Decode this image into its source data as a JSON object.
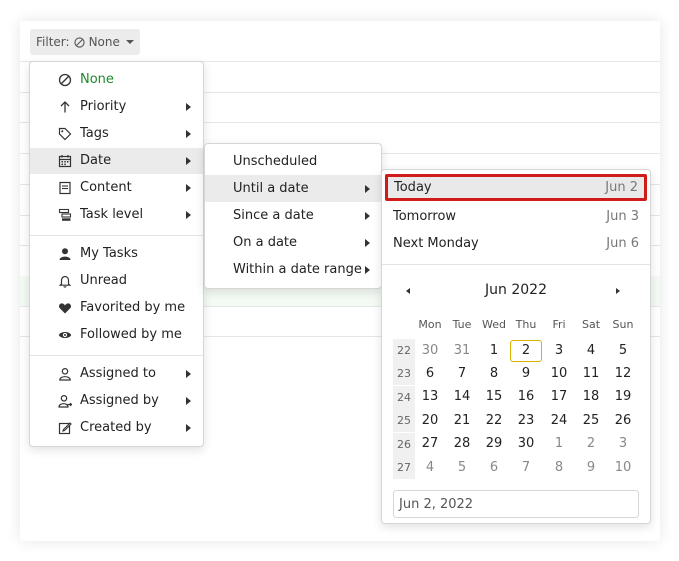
{
  "filter": {
    "label": "Filter:",
    "value": "None"
  },
  "main_menu": {
    "items": [
      {
        "label": "None"
      },
      {
        "label": "Priority"
      },
      {
        "label": "Tags"
      },
      {
        "label": "Date"
      },
      {
        "label": "Content"
      },
      {
        "label": "Task level"
      },
      {
        "label": "My Tasks"
      },
      {
        "label": "Unread"
      },
      {
        "label": "Favorited by me"
      },
      {
        "label": "Followed by me"
      },
      {
        "label": "Assigned to"
      },
      {
        "label": "Assigned by"
      },
      {
        "label": "Created by"
      }
    ]
  },
  "date_menu": {
    "items": [
      {
        "label": "Unscheduled"
      },
      {
        "label": "Until a date"
      },
      {
        "label": "Since a date"
      },
      {
        "label": "On a date"
      },
      {
        "label": "Within a date range"
      }
    ]
  },
  "until_menu": {
    "quick": [
      {
        "label": "Today",
        "date": "Jun 2"
      },
      {
        "label": "Tomorrow",
        "date": "Jun 3"
      },
      {
        "label": "Next Monday",
        "date": "Jun 6"
      }
    ],
    "calendar": {
      "title": "Jun 2022",
      "weekdays": [
        "Mon",
        "Tue",
        "Wed",
        "Thu",
        "Fri",
        "Sat",
        "Sun"
      ],
      "weeks": [
        {
          "num": "22",
          "days": [
            "30",
            "31",
            "1",
            "2",
            "3",
            "4",
            "5"
          ]
        },
        {
          "num": "23",
          "days": [
            "6",
            "7",
            "8",
            "9",
            "10",
            "11",
            "12"
          ]
        },
        {
          "num": "24",
          "days": [
            "13",
            "14",
            "15",
            "16",
            "17",
            "18",
            "19"
          ]
        },
        {
          "num": "25",
          "days": [
            "20",
            "21",
            "22",
            "23",
            "24",
            "25",
            "26"
          ]
        },
        {
          "num": "26",
          "days": [
            "27",
            "28",
            "29",
            "30",
            "1",
            "2",
            "3"
          ]
        },
        {
          "num": "27",
          "days": [
            "4",
            "5",
            "6",
            "7",
            "8",
            "9",
            "10"
          ]
        }
      ]
    },
    "input_value": "Jun 2, 2022"
  },
  "colors": {
    "accent_green": "#1f8a2b",
    "highlight_border": "#d11a1a",
    "today_border": "#d9b200"
  }
}
